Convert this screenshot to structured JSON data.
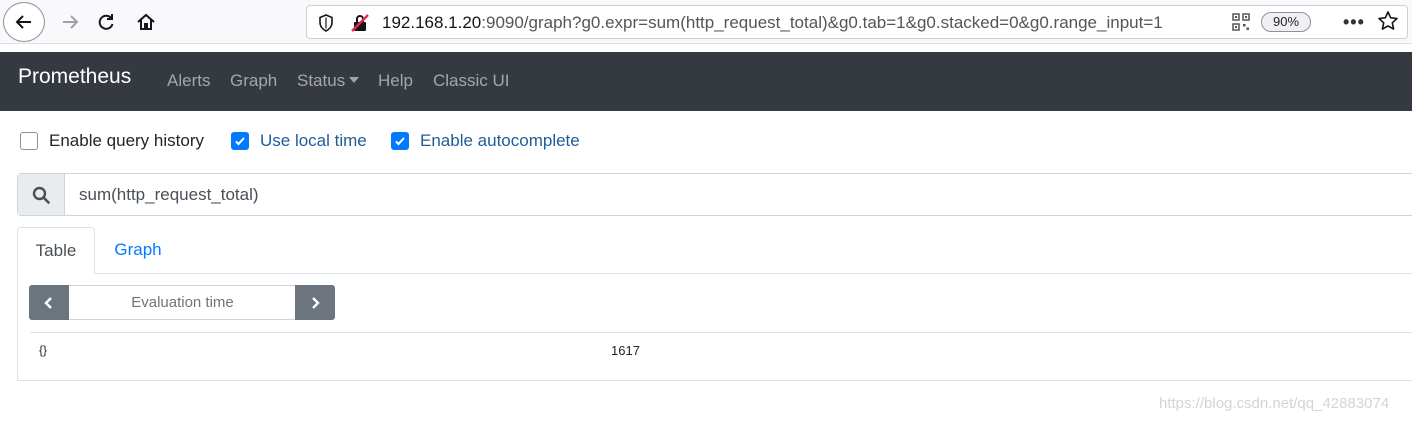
{
  "browser": {
    "url_host": "192.168.1.20",
    "url_rest": ":9090/graph?g0.expr=sum(http_request_total)&g0.tab=1&g0.stacked=0&g0.range_input=1",
    "zoom": "90%",
    "icons": [
      "back-icon",
      "forward-icon",
      "reload-icon",
      "home-icon",
      "shield-icon",
      "insecure-lock-icon",
      "qr-code-icon",
      "more-icon",
      "bookmark-star-icon"
    ]
  },
  "navbar": {
    "brand": "Prometheus",
    "links": {
      "alerts": "Alerts",
      "graph": "Graph",
      "status": "Status",
      "help": "Help",
      "classic": "Classic UI"
    }
  },
  "options": {
    "query_history": {
      "label": "Enable query history",
      "checked": false
    },
    "local_time": {
      "label": "Use local time",
      "checked": true
    },
    "autocomplete": {
      "label": "Enable autocomplete",
      "checked": true
    }
  },
  "query": {
    "expression": "sum(http_request_total)"
  },
  "tabs": {
    "table": "Table",
    "graph": "Graph",
    "active": "Table"
  },
  "eval_time": {
    "placeholder": "Evaluation time"
  },
  "results": [
    {
      "labels": "{}",
      "value": "1617"
    }
  ],
  "watermark": "https://blog.csdn.net/qq_42883074",
  "colors": {
    "navbar_bg": "#343a40",
    "accent": "#007bff",
    "button_bg": "#6c757d"
  }
}
